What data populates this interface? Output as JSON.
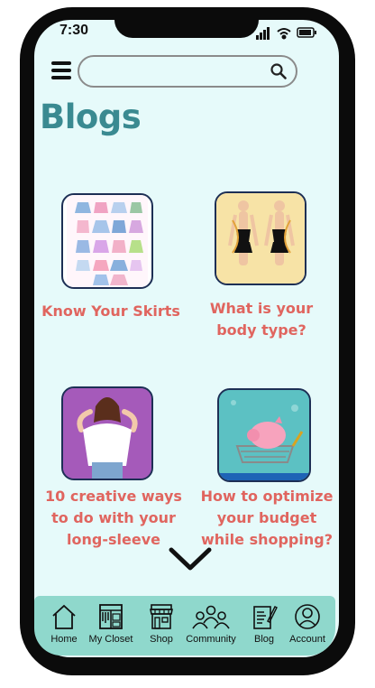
{
  "status": {
    "time": "7:30"
  },
  "header": {
    "search_placeholder": ""
  },
  "page": {
    "title": "Blogs"
  },
  "blogs": [
    {
      "title": "Know Your Skirts"
    },
    {
      "title": "What is your body type?"
    },
    {
      "title": "10 creative ways to do with your long-sleeve"
    },
    {
      "title": "How to optimize your budget while shopping?"
    }
  ],
  "nav": [
    {
      "label": "Home",
      "icon": "home-icon"
    },
    {
      "label": "My Closet",
      "icon": "closet-icon"
    },
    {
      "label": "Shop",
      "icon": "shop-icon"
    },
    {
      "label": "Community",
      "icon": "community-icon"
    },
    {
      "label": "Blog",
      "icon": "blog-icon"
    },
    {
      "label": "Account",
      "icon": "account-icon"
    }
  ],
  "colors": {
    "accent": "#3a8a91",
    "card_title": "#e0655f",
    "nav_bg": "#8fd8cc",
    "screen_bg": "#e6fafa"
  }
}
